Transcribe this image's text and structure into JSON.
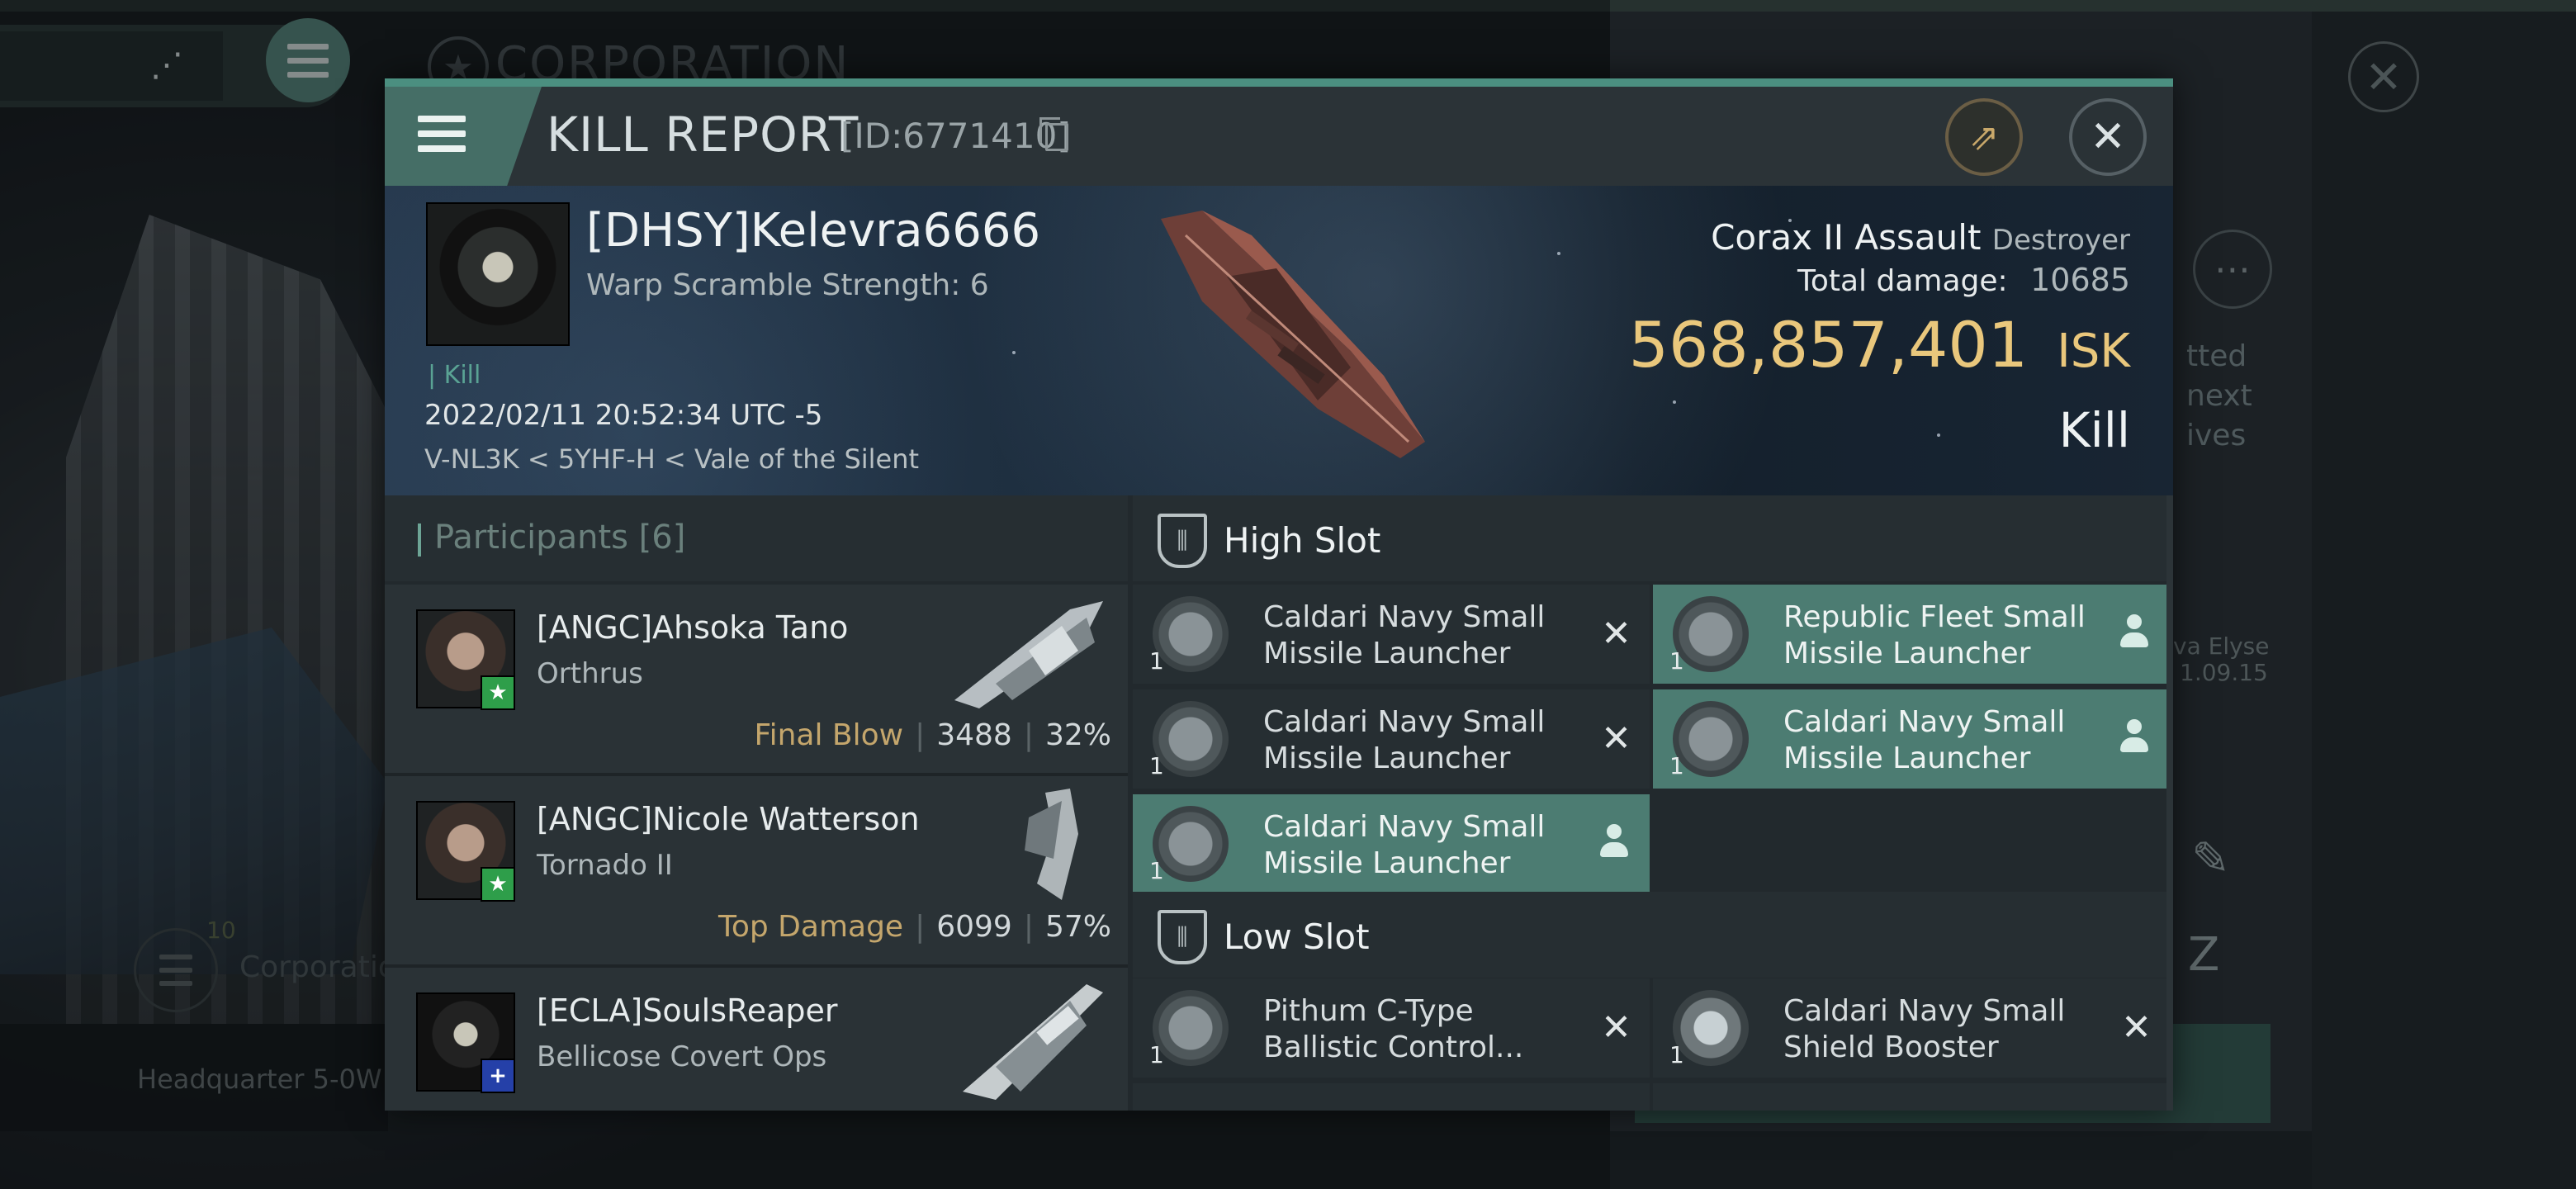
{
  "background": {
    "corporation_title": "CORPORATION",
    "right_text_lines": [
      "tted",
      "next",
      "ives"
    ],
    "side_note_lines": [
      "va Elyse",
      "1.09.15"
    ],
    "corp_count": "10",
    "corp_label": "Corporatio",
    "hq_label": "Headquarter 5-0W"
  },
  "header": {
    "title": "KILL REPORT",
    "report_id": "[ID:6771410]"
  },
  "victim": {
    "name": "[DHSY]Kelevra6666",
    "warp_scramble": "Warp Scramble Strength: 6",
    "kill_tag": "| Kill",
    "datetime": "2022/02/11 20:52:34 UTC -5",
    "location": "V-NL3K < 5YHF-H < Vale of the Silent",
    "ship_name": "Corax II Assault",
    "ship_class": "Destroyer",
    "total_damage_label": "Total damage:",
    "total_damage_value": "10685",
    "isk_value": "568,857,401",
    "isk_unit": "ISK",
    "result": "Kill"
  },
  "participants": {
    "label": "Participants [6]",
    "items": [
      {
        "name": "[ANGC]Ahsoka Tano",
        "ship": "Orthrus",
        "tag": "Final Blow",
        "damage": "3488",
        "percent": "32%"
      },
      {
        "name": "[ANGC]Nicole Watterson",
        "ship": "Tornado II",
        "tag": "Top Damage",
        "damage": "6099",
        "percent": "57%"
      },
      {
        "name": "[ECLA]SoulsReaper",
        "ship": "Bellicose Covert Ops",
        "tag": "",
        "damage": "",
        "percent": ""
      }
    ]
  },
  "high_slot": {
    "label": "High Slot",
    "modules": [
      {
        "name": "Caldari Navy Small Missile Launcher",
        "qty": "1",
        "status": "destroyed"
      },
      {
        "name": "Republic Fleet Small Missile Launcher",
        "qty": "1",
        "status": "dropped"
      },
      {
        "name": "Caldari Navy Small Missile Launcher",
        "qty": "1",
        "status": "destroyed"
      },
      {
        "name": "Caldari Navy Small Missile Launcher",
        "qty": "1",
        "status": "dropped"
      },
      {
        "name": "Caldari Navy Small Missile Launcher",
        "qty": "1",
        "status": "dropped"
      }
    ]
  },
  "low_slot": {
    "label": "Low Slot",
    "modules": [
      {
        "name": "Pithum C-Type Ballistic Control...",
        "qty": "1",
        "status": "destroyed"
      },
      {
        "name": "Caldari Navy Small Shield Booster",
        "qty": "1",
        "status": "destroyed"
      }
    ]
  },
  "icons": {
    "menu": "menu-icon",
    "close": "close-icon",
    "share": "share-icon",
    "copy": "copy-icon",
    "destroyed": "x-icon",
    "dropped": "pilot-icon"
  },
  "colors": {
    "accent": "#4b8f80",
    "isk": "#e9c77c",
    "dropped_module_bg": "#4c7c72",
    "final_blow": "#c4a66c"
  }
}
